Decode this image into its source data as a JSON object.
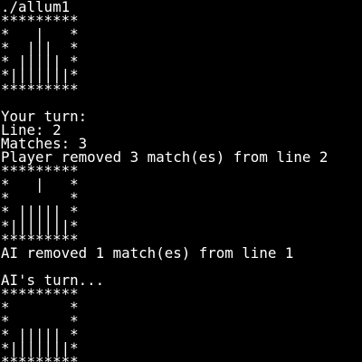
{
  "terminal": {
    "lines": [
      "./allum1",
      "*********",
      "*   |   *",
      "*  |||  *",
      "* ||||| *",
      "*|||||||*",
      "*********",
      "",
      "Your turn:",
      "Line: 2",
      "Matches: 3",
      "Player removed 3 match(es) from line 2",
      "*********",
      "*   |   *",
      "*       *",
      "* ||||| *",
      "*|||||||*",
      "*********",
      "AI removed 1 match(es) from line 1",
      "",
      "AI's turn...",
      "*********",
      "*       *",
      "*       *",
      "* ||||| *",
      "*|||||||*",
      "*********"
    ]
  }
}
